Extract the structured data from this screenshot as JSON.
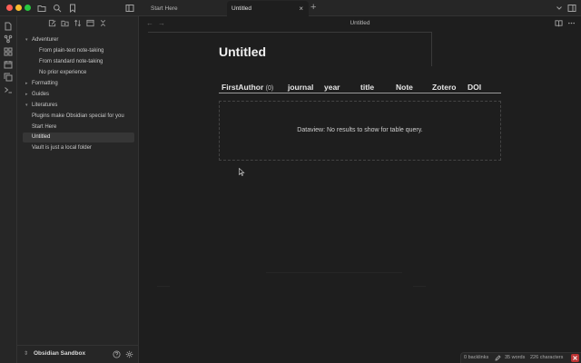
{
  "tabs": [
    {
      "label": "Start Here",
      "active": false
    },
    {
      "label": "Untitled",
      "active": true
    }
  ],
  "tab_close_glyph": "×",
  "tab_new_glyph": "+",
  "sidebar": {
    "tree": [
      {
        "label": "Adventurer",
        "type": "folder",
        "expanded": true,
        "level": 0
      },
      {
        "label": "From plain-text note-taking",
        "type": "file",
        "level": 1
      },
      {
        "label": "From standard note-taking",
        "type": "file",
        "level": 1
      },
      {
        "label": "No prior experience",
        "type": "file",
        "level": 1
      },
      {
        "label": "Formatting",
        "type": "folder",
        "expanded": false,
        "level": 0
      },
      {
        "label": "Guides",
        "type": "folder",
        "expanded": false,
        "level": 0
      },
      {
        "label": "Literatures",
        "type": "folder",
        "expanded": true,
        "level": 0
      },
      {
        "label": "Plugins make Obsidian special for you",
        "type": "file",
        "level": 0
      },
      {
        "label": "Start Here",
        "type": "file",
        "level": 0
      },
      {
        "label": "Untitled",
        "type": "file",
        "level": 0,
        "active": true
      },
      {
        "label": "Vault is just a local folder",
        "type": "file",
        "level": 0
      }
    ],
    "vault_name": "Obsidian Sandbox"
  },
  "editor": {
    "header_title": "Untitled",
    "doc_title": "Untitled",
    "table": {
      "columns": [
        {
          "label": "FirstAuthor",
          "count": "(0)"
        },
        {
          "label": "journal"
        },
        {
          "label": "year"
        },
        {
          "label": "title"
        },
        {
          "label": "Note"
        },
        {
          "label": "Zotero"
        },
        {
          "label": "DOI"
        }
      ],
      "empty_message": "Dataview: No results to show for table query."
    }
  },
  "statusbar": {
    "backlinks": "0 backlinks",
    "words": "35 words",
    "characters": "226 characters"
  },
  "colors": {
    "background": "#1e1e1e",
    "sidebar": "#262626",
    "close_red": "#ff5f57",
    "minimize_yellow": "#febc2e",
    "zoom_green": "#28c840",
    "error_badge": "#bb3333"
  }
}
